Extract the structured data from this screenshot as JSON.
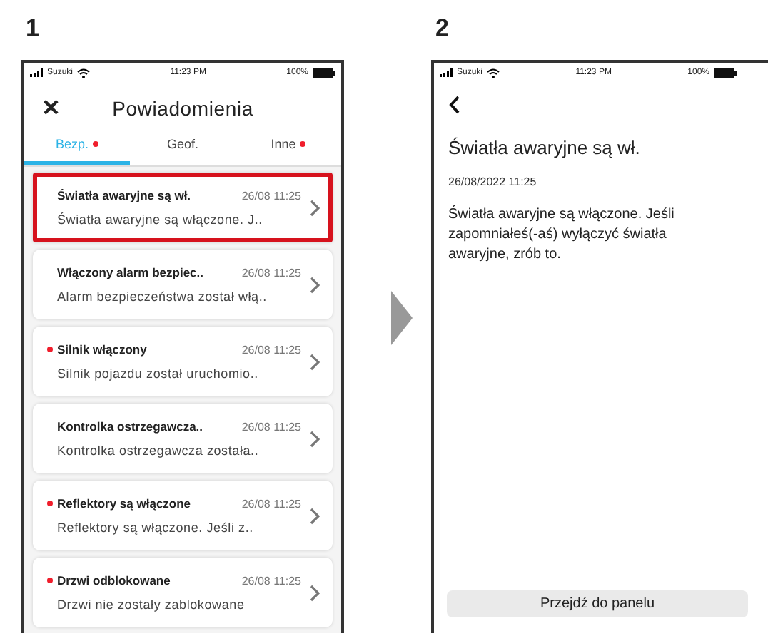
{
  "steps": [
    {
      "number": "1"
    },
    {
      "number": "2"
    }
  ],
  "list_screen": {
    "status_bar": {
      "carrier": "Suzuki",
      "time": "11:23 PM",
      "battery": "100%"
    },
    "close_icon": "✕",
    "title": "Powiadomienia",
    "tabs": [
      {
        "label": "Bezp.",
        "selected": true,
        "unread": true
      },
      {
        "label": "Geof.",
        "selected": false,
        "unread": false
      },
      {
        "label": "Inne",
        "selected": false,
        "unread": true
      }
    ],
    "notifications": [
      {
        "title": "Światła awaryjne są wł.",
        "time": "26/08 11:25",
        "preview": "Światła awaryjne są włączone. J..",
        "unread": false,
        "highlighted": true
      },
      {
        "title": "Włączony alarm bezpiec..",
        "time": "26/08 11:25",
        "preview": "Alarm bezpieczeństwa został włą..",
        "unread": false,
        "highlighted": false
      },
      {
        "title": "Silnik włączony",
        "time": "26/08 11:25",
        "preview": "Silnik pojazdu został uruchomio..",
        "unread": true,
        "highlighted": false
      },
      {
        "title": "Kontrolka ostrzegawcza..",
        "time": "26/08 11:25",
        "preview": "Kontrolka ostrzegawcza została..",
        "unread": false,
        "highlighted": false
      },
      {
        "title": "Reflektory są włączone",
        "time": "26/08 11:25",
        "preview": "Reflektory są włączone. Jeśli z..",
        "unread": true,
        "highlighted": false
      },
      {
        "title": "Drzwi odblokowane",
        "time": "26/08 11:25",
        "preview": "Drzwi nie zostały zablokowane",
        "unread": true,
        "highlighted": false
      }
    ]
  },
  "detail_screen": {
    "status_bar": {
      "carrier": "Suzuki",
      "time": "11:23 PM",
      "battery": "100%"
    },
    "title": "Światła awaryjne są wł.",
    "date": "26/08/2022 11:25",
    "body": "Światła awaryjne są włączone. Jeśli zapomniałeś(-aś) wyłączyć światła awaryjne, zrób to.",
    "button": "Przejdź do panelu"
  }
}
